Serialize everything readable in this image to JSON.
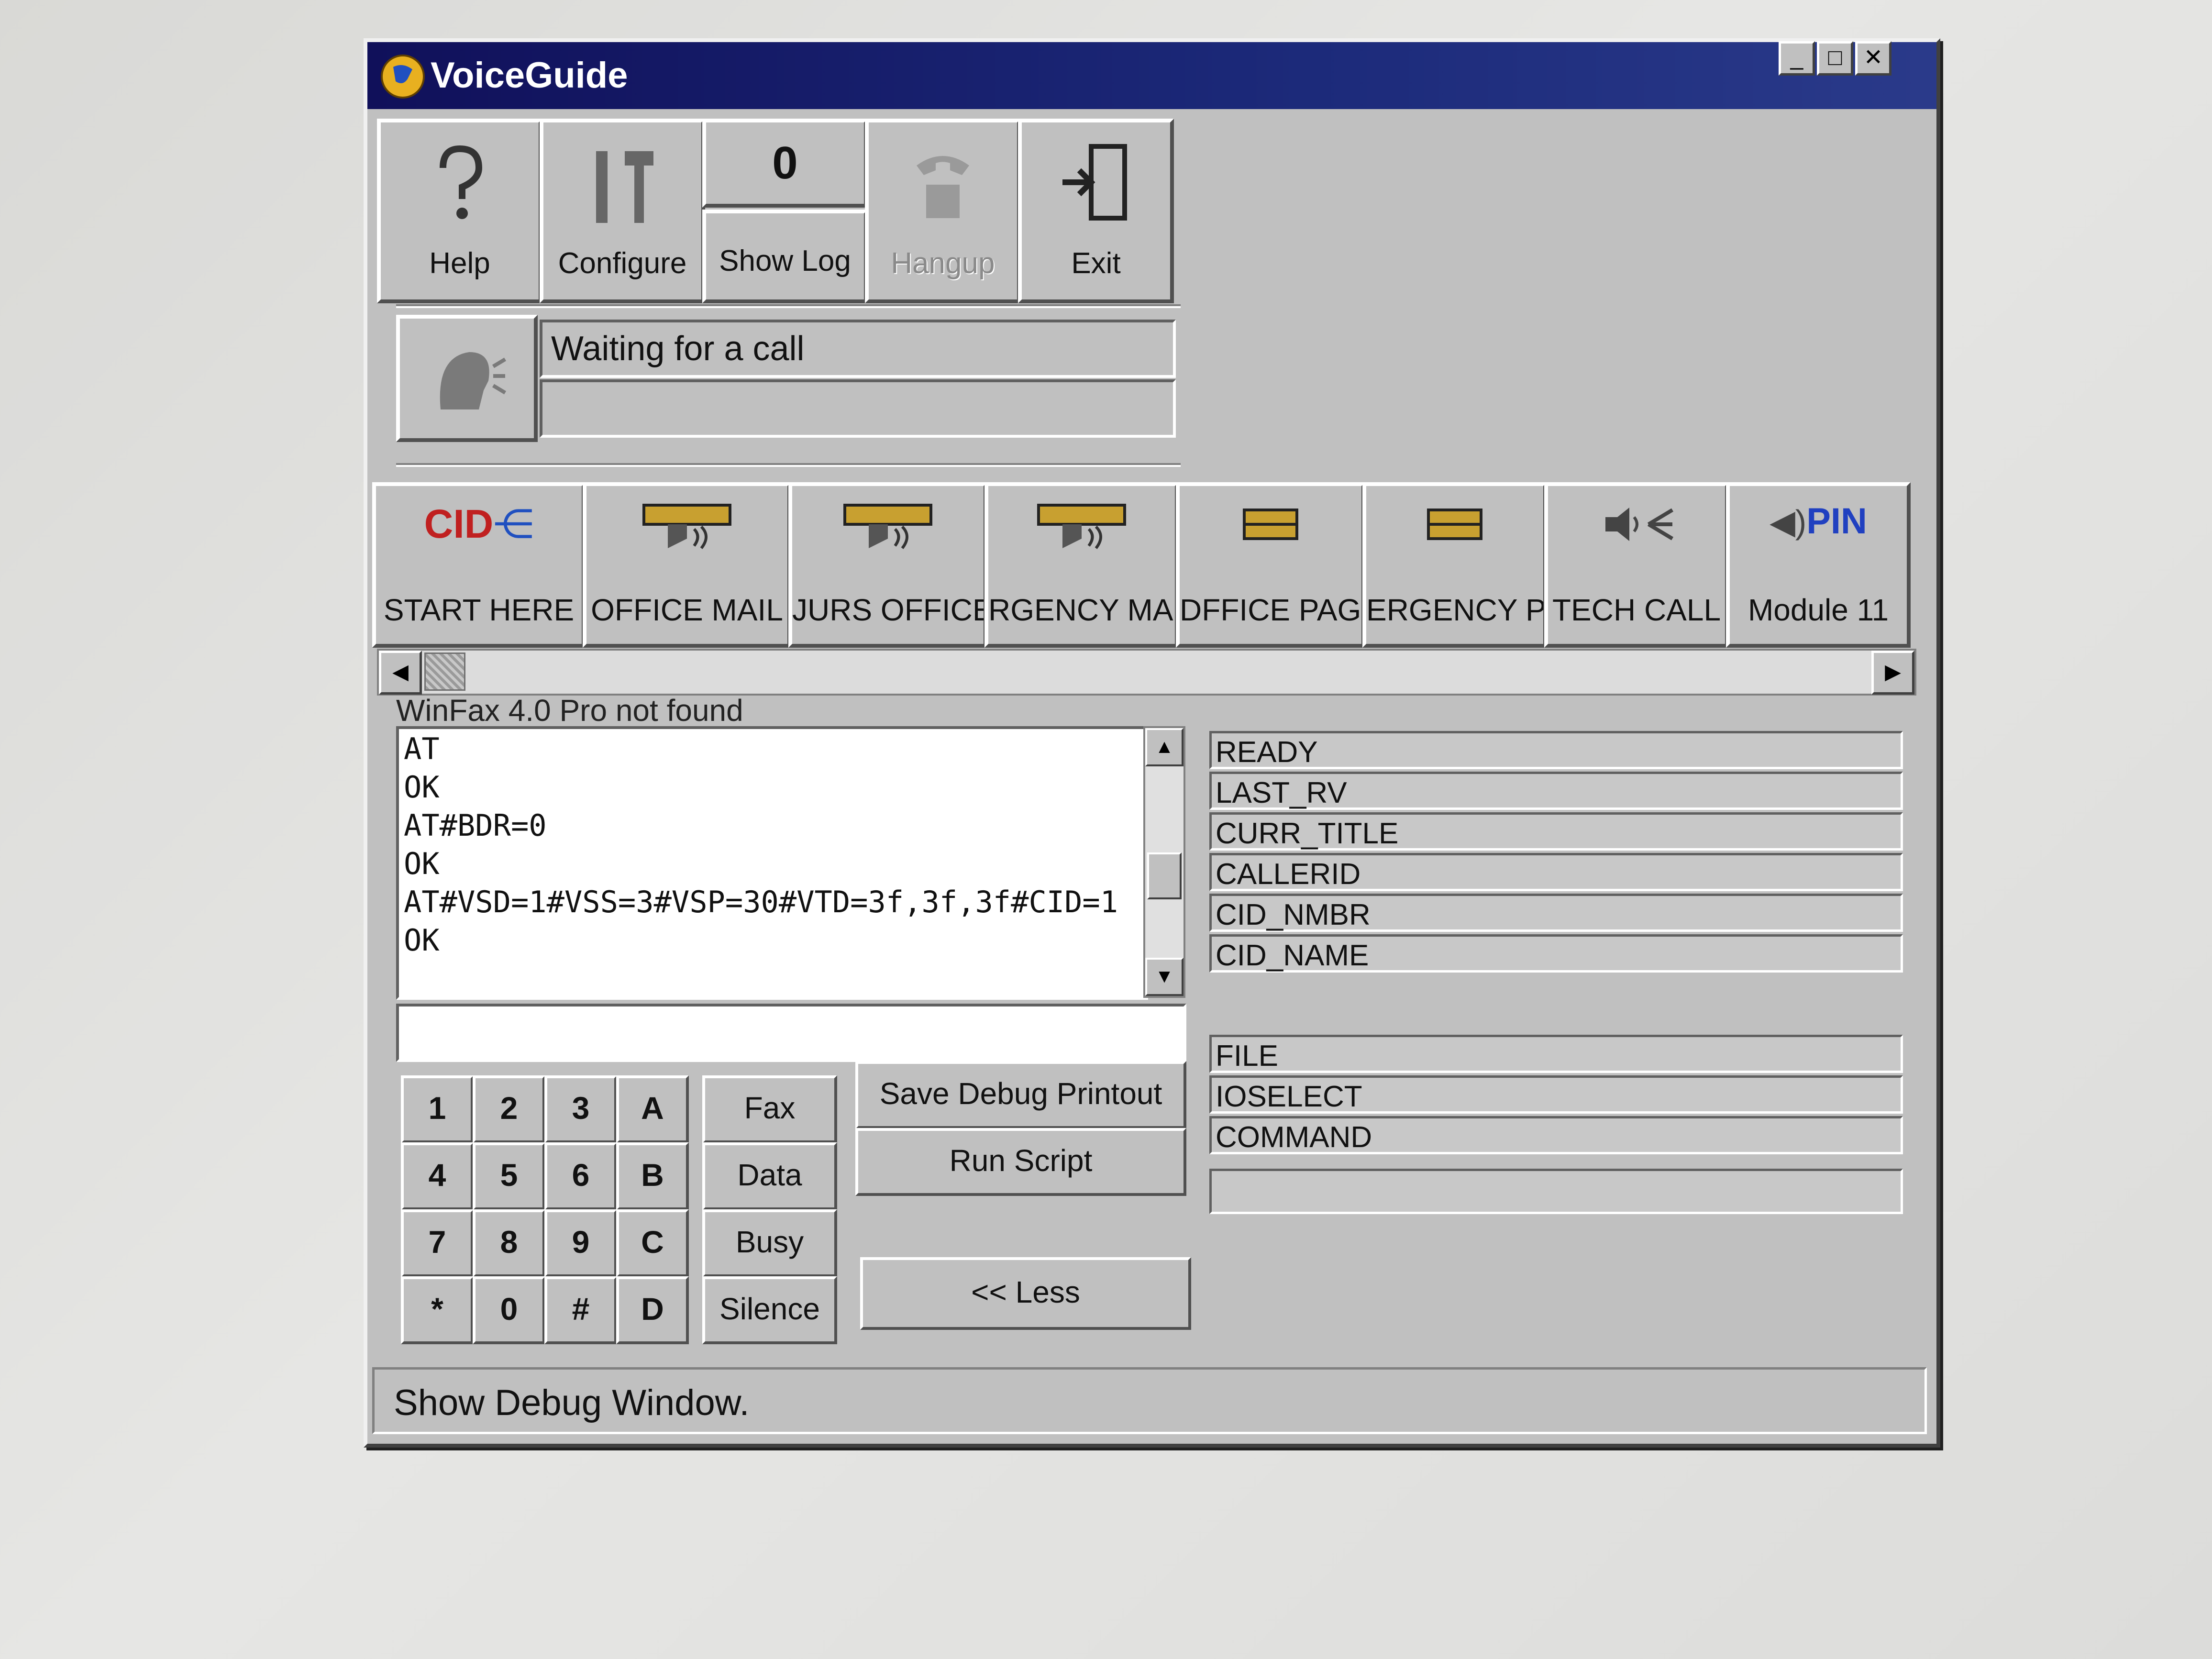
{
  "window": {
    "title": "VoiceGuide",
    "controls": {
      "minimize": "_",
      "maximize": "□",
      "close": "✕"
    }
  },
  "toolbar": {
    "help": "Help",
    "configure": "Configure",
    "counter": "0",
    "show_log": "Show Log",
    "hangup": "Hangup",
    "exit": "Exit"
  },
  "status": {
    "line1": "Waiting for a call",
    "line2": ""
  },
  "modules": [
    {
      "label": "START HERE",
      "badge": "CID",
      "icon": "cid-split-icon"
    },
    {
      "label": "OFFICE MAIL",
      "icon": "tape-speaker-icon"
    },
    {
      "label": "JURS OFFICE",
      "icon": "tape-speaker-icon"
    },
    {
      "label": "RGENCY MAIL",
      "icon": "tape-speaker-icon"
    },
    {
      "label": "DFFICE PAGE",
      "icon": "tape-icon"
    },
    {
      "label": "ERGENCY PA",
      "icon": "tape-icon"
    },
    {
      "label": "TECH CALL",
      "icon": "speaker-split-icon"
    },
    {
      "label": "Module 11",
      "badge": "PIN",
      "icon": "speaker-pin-icon"
    }
  ],
  "winfax_note": "WinFax 4.0 Pro not found",
  "log_lines": [
    "AT",
    "OK",
    "AT#BDR=0",
    "OK",
    "AT#VSD=1#VSS=3#VSP=30#VTD=3f,3f,3f#CID=1",
    "OK"
  ],
  "command_input": "",
  "fields_top": [
    "READY",
    "LAST_RV",
    "CURR_TITLE",
    "CALLERID",
    "CID_NMBR",
    "CID_NAME"
  ],
  "fields_bottom": [
    "FILE",
    "IOSELECT",
    "COMMAND",
    ""
  ],
  "keypad": [
    "1",
    "2",
    "3",
    "A",
    "4",
    "5",
    "6",
    "B",
    "7",
    "8",
    "9",
    "C",
    "*",
    "0",
    "#",
    "D"
  ],
  "signal_buttons": [
    "Fax",
    "Data",
    "Busy",
    "Silence"
  ],
  "actions": {
    "save_debug": "Save Debug Printout",
    "run_script": "Run Script",
    "less": "<< Less"
  },
  "statusbar": "Show Debug Window."
}
